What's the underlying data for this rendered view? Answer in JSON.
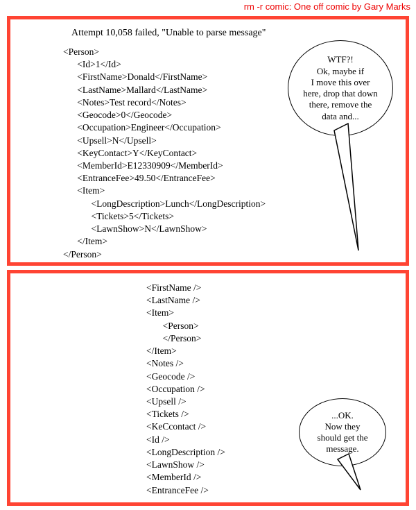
{
  "title": "rm -r comic: One off comic by Gary Marks",
  "panel1": {
    "error": "Attempt 10,058 failed, \"Unable to parse message\"",
    "xml": "<Person>\n      <Id>1</Id>\n      <FirstName>Donald</FirstName>\n      <LastName>Mallard</LastName>\n      <Notes>Test record</Notes>\n      <Geocode>0</Geocode>\n      <Occupation>Engineer</Occupation>\n      <Upsell>N</Upsell>\n      <KeyContact>Y</KeyContact>\n      <MemberId>E12330909</MemberId>\n      <EntranceFee>49.50</EntranceFee>\n      <Item>\n            <LongDescription>Lunch</LongDescription>\n            <Tickets>5</Tickets>\n            <LawnShow>N</LawnShow>\n      </Item>\n</Person>",
    "speech": "WTF?!\nOk, maybe if\nI move this over\nhere, drop that down\nthere, remove the\ndata and..."
  },
  "panel2": {
    "xml": "<FirstName />\n<LastName />\n<Item>\n       <Person>\n       </Person>\n</Item>\n<Notes />\n<Geocode />\n<Occupation />\n<Upsell />\n<Tickets />\n<KeCcontact />\n<Id />\n<LongDescription />\n<LawnShow />\n<MemberId />\n<EntranceFee />",
    "speech": "...OK.\nNow they\nshould get the\nmessage."
  }
}
